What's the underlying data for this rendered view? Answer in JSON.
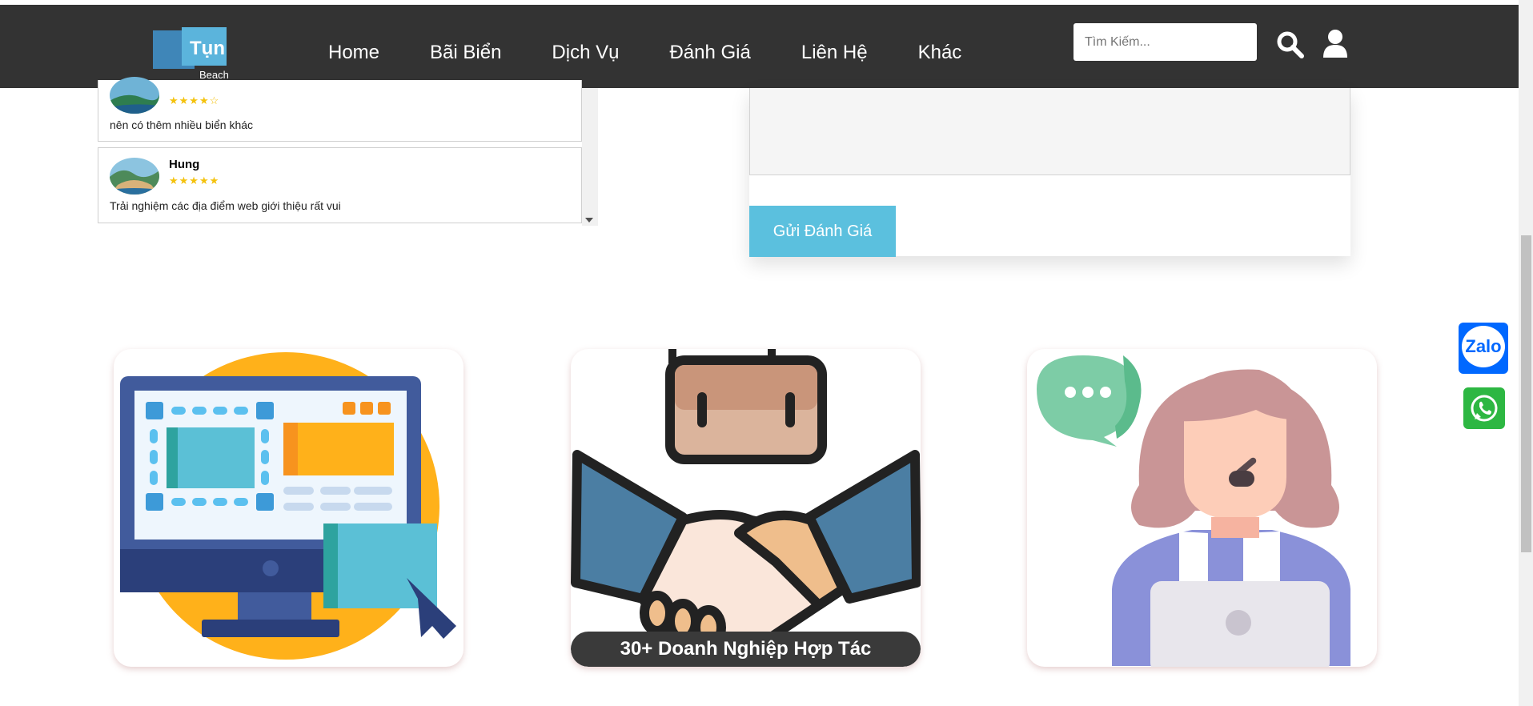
{
  "header": {
    "logo_text": "Tụn",
    "logo_sub": "Beach",
    "nav": [
      "Home",
      "Bãi Biển",
      "Dịch Vụ",
      "Đánh Giá",
      "Liên Hệ",
      "Khác"
    ],
    "search_placeholder": "Tìm Kiếm..."
  },
  "reviews": [
    {
      "name": "",
      "stars": "★★★★☆",
      "text": "nên có thêm nhiều biển khác"
    },
    {
      "name": "Hung",
      "stars": "★★★★★",
      "text": "Trải nghiệm các địa điểm web giới thiệu rất vui"
    }
  ],
  "form": {
    "submit_label": "Gửi Đánh Giá"
  },
  "features": [
    {
      "label": ""
    },
    {
      "label": "30+ Doanh Nghiệp Hợp Tác"
    },
    {
      "label": ""
    }
  ],
  "side": {
    "zalo_label": "Zalo"
  },
  "colors": {
    "header_bg": "#333333",
    "accent": "#5bc0de",
    "zalo": "#0068ff",
    "whatsapp": "#2db742",
    "star": "#f4c20d"
  },
  "icons": [
    "search-icon",
    "user-icon",
    "zalo-icon",
    "whatsapp-icon"
  ]
}
